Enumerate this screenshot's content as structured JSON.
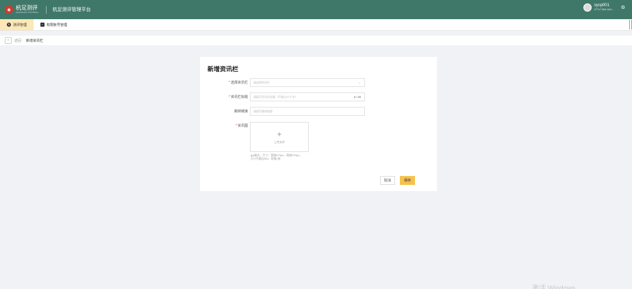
{
  "header": {
    "logo_text": "杭足测评",
    "logo_subtext": "HANGZHOU FOOTBALL",
    "platform_title": "杭足测评管理平台",
    "user_name": "sycp001",
    "user_id": "277e73b6-be0..."
  },
  "tabs": [
    {
      "label": "测评管理",
      "active": true
    },
    {
      "label": "权限账号管理",
      "active": false
    }
  ],
  "breadcrumb": {
    "back_label": "返回",
    "current": "新增资讯栏"
  },
  "form": {
    "title": "新增资讯栏",
    "required_mark": "*",
    "fields": {
      "category": {
        "label": "选择资讯栏",
        "placeholder": "请选择资讯栏",
        "required": true
      },
      "title": {
        "label": "资讯栏标题",
        "placeholder": "请填写资讯栏标题（不超过20个字）",
        "counter": "0 / 20",
        "required": true
      },
      "link": {
        "label": "跳转链接",
        "placeholder": "请填写跳转链接",
        "required": false
      },
      "image": {
        "label": "资讯图",
        "upload_text": "上传文件",
        "required": true
      }
    },
    "hint_line1": "jpg格式、尺寸：宽度670px、高度320px。",
    "hint_line2": "大小不超过5M，仅限1张",
    "cancel_label": "取消",
    "save_label": "保存"
  },
  "watermark": "激活 Windows",
  "colors": {
    "header_bg": "#3f7868",
    "active_tab_bg": "#fbe8b6",
    "save_button": "#f5c24d",
    "required_mark": "#e9442c"
  }
}
